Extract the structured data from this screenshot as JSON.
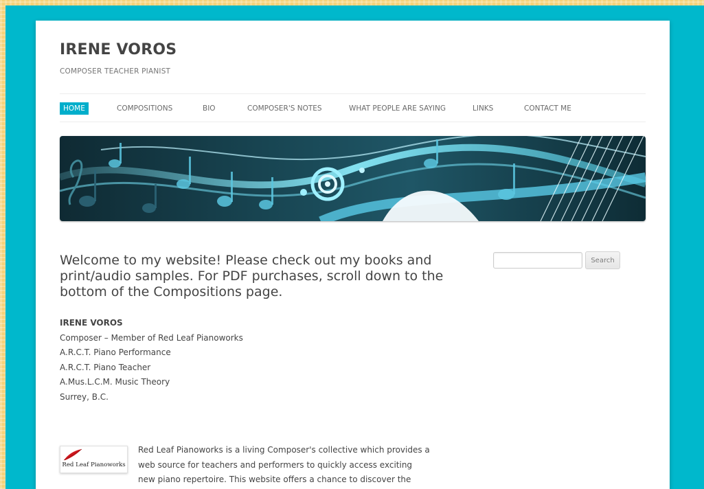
{
  "site": {
    "title": "IRENE VOROS",
    "description": "COMPOSER TEACHER PIANIST"
  },
  "nav": {
    "items": [
      {
        "label": "HOME",
        "active": true
      },
      {
        "label": "COMPOSITIONS",
        "active": false
      },
      {
        "label": "BIO",
        "active": false
      },
      {
        "label": "COMPOSER'S NOTES",
        "active": false
      },
      {
        "label": "WHAT PEOPLE ARE SAYING",
        "active": false
      },
      {
        "label": "LINKS",
        "active": false
      },
      {
        "label": "CONTACT ME",
        "active": false
      }
    ]
  },
  "main": {
    "welcome": "Welcome to my website! Please check out my books and print/audio samples. For PDF purchases, scroll down to the bottom of the Compositions page.",
    "bio": {
      "name": "IRENE VOROS",
      "lines": [
        "Composer – Member of Red Leaf Pianoworks",
        "A.R.C.T. Piano Performance",
        "A.R.C.T. Piano Teacher",
        "A.Mus.L.C.M. Music Theory",
        "Surrey, B.C."
      ]
    },
    "red_leaf": {
      "logo_text": "Red Leaf Pianoworks",
      "paragraph": "Red Leaf Pianoworks is a living Composer's collective which provides a web source for teachers and performers to quickly access exciting new piano repertoire. This website offers a chance to discover the latest new"
    }
  },
  "sidebar": {
    "search": {
      "placeholder": "",
      "button_label": "Search"
    }
  },
  "colors": {
    "frame": "#00b8cc",
    "accent": "#00aecb",
    "page_bg": "#ffffff",
    "text": "#444444",
    "logo_leaf": "#d0181e"
  },
  "icons": {
    "logo": "red-leaf-icon"
  }
}
